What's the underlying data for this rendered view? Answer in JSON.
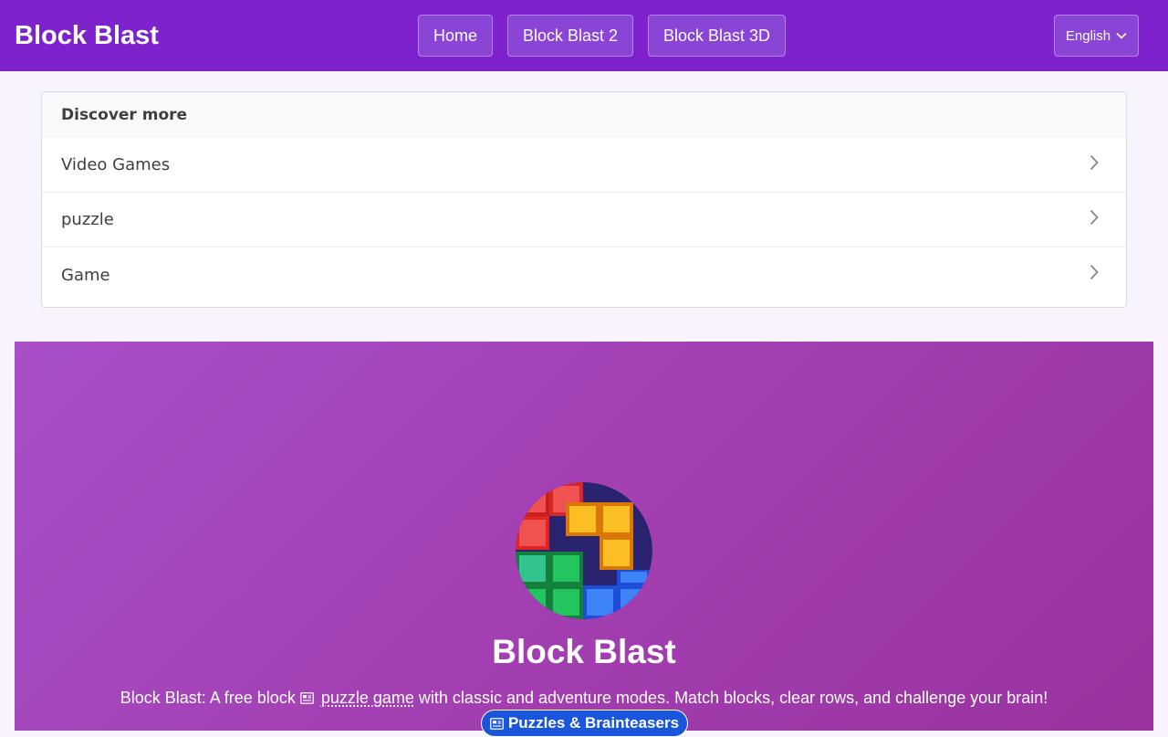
{
  "header": {
    "brand": "Block Blast",
    "nav": {
      "home": "Home",
      "block_blast_2": "Block Blast 2",
      "block_blast_3d": "Block Blast 3D"
    },
    "language": {
      "selected": "English",
      "icon": "chevron-down-icon"
    }
  },
  "discover": {
    "title": "Discover more",
    "items": [
      {
        "label": "Video Games",
        "icon": "chevron-right-icon"
      },
      {
        "label": "puzzle",
        "icon": "chevron-right-icon"
      },
      {
        "label": "Game",
        "icon": "chevron-right-icon"
      }
    ]
  },
  "hero": {
    "title": "Block Blast",
    "description_before": "Block Blast: A free block",
    "description_link": "puzzle game",
    "description_after": "with classic and adventure modes. Match blocks, clear rows, and challenge your brain!",
    "category_chip": "Puzzles & Brainteasers",
    "icons": {
      "link_icon": "newspaper-icon",
      "chip_icon": "newspaper-icon"
    }
  },
  "colors": {
    "header_bg": "#7e22ce",
    "page_bg": "#f8f3fc",
    "hero_gradient_start": "#a94fc8",
    "hero_gradient_end": "#9a33a0",
    "chip_bg": "#1a56db"
  }
}
